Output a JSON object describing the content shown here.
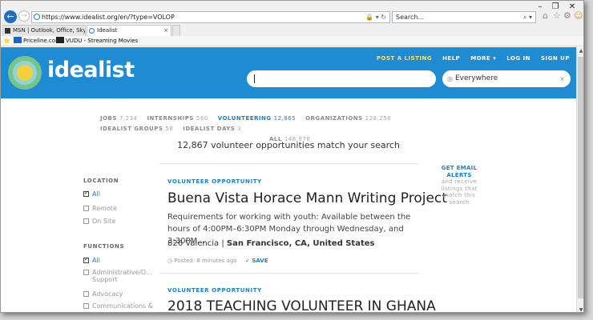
{
  "browser": {
    "url": "https://www.idealist.org/en/?type=VOLOP",
    "search_placeholder": "Search...",
    "tabs": [
      {
        "label": "MSN | Outlook, Office, Skype, ..."
      },
      {
        "label": "Idealist"
      }
    ],
    "favorites": [
      {
        "label": "Priceline.com"
      },
      {
        "label": "VUDU - Streaming Movies"
      }
    ],
    "window_controls": {
      "minimize": "–",
      "restore": "❐",
      "close": "✕"
    }
  },
  "site": {
    "logo_text": "idealist",
    "nav": {
      "post": "POST A LISTING",
      "help": "HELP",
      "more": "MORE ▾",
      "login": "LOG IN",
      "signup": "SIGN UP"
    },
    "search": {
      "keyword_value": "",
      "location_value": "Everywhere",
      "clear": "×"
    },
    "brand_color": "#1f8bd3",
    "accent_color": "#1f7fc3"
  },
  "categories": [
    {
      "label": "JOBS",
      "count": "7,234"
    },
    {
      "label": "INTERNSHIPS",
      "count": "560"
    },
    {
      "label": "VOLUNTEERING",
      "count": "12,865"
    },
    {
      "label": "ORGANIZATIONS",
      "count": "128,258"
    },
    {
      "label": "IDEALIST GROUPS",
      "count": "58"
    },
    {
      "label": "IDEALIST DAYS",
      "count": "3"
    },
    {
      "label": "ALL",
      "count": "148,978"
    }
  ],
  "active_category": "VOLUNTEERING",
  "match_text": "12,867 volunteer opportunities match your search",
  "filters": {
    "location_title": "LOCATION",
    "location": [
      {
        "label": "All",
        "checked": true
      },
      {
        "label": "Remote",
        "checked": false
      },
      {
        "label": "On Site",
        "checked": false
      }
    ],
    "functions_title": "FUNCTIONS",
    "functions": [
      {
        "label": "All",
        "checked": true
      },
      {
        "label": "Administrative/O...",
        "label2": "Support",
        "checked": false
      },
      {
        "label": "Advocacy",
        "checked": false
      },
      {
        "label": "Communications &",
        "checked": false
      }
    ]
  },
  "listings": [
    {
      "badge": "VOLUNTEER OPPORTUNITY",
      "title": "Buena Vista Horace Mann Writing Project",
      "description": "Requirements for working with youth: Available between the hours of 4:00PM–6:30PM Monday through Wednesday, and 3:30PM…",
      "address": "826 Valencia",
      "location": "San Francisco, CA, United States",
      "posted": "Posted: 8 minutes ago",
      "save": "SAVE"
    },
    {
      "badge": "VOLUNTEER OPPORTUNITY",
      "title": "2018 TEACHING VOLUNTEER IN GHANA"
    }
  ],
  "alerts": {
    "link": "GET EMAIL ALERTS",
    "text": "and receive listings that match this search"
  }
}
